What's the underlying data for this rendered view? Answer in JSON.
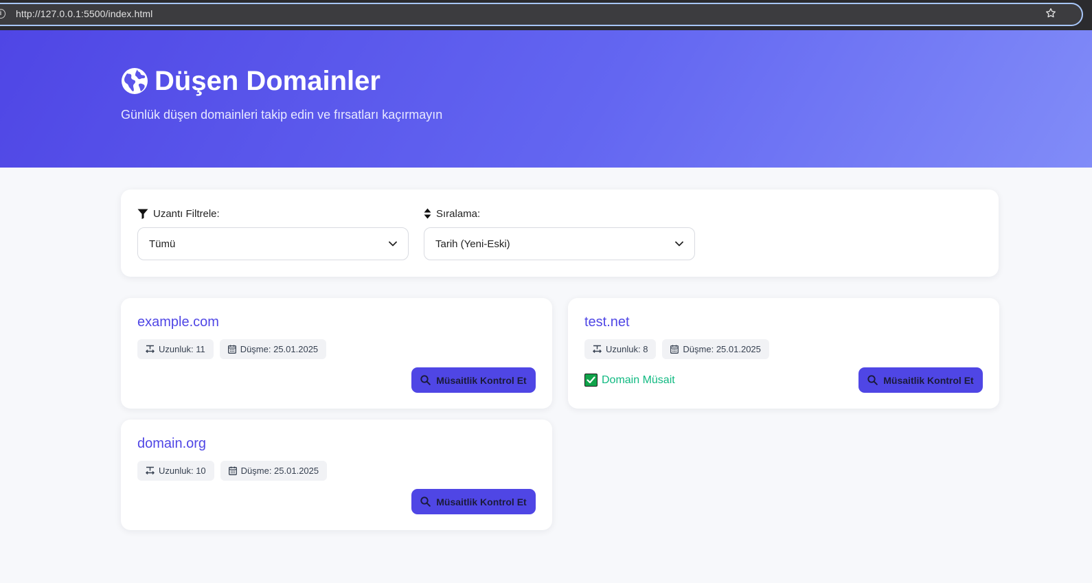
{
  "browser": {
    "url": "http://127.0.0.1:5500/index.html"
  },
  "header": {
    "title": "Düşen Domainler",
    "subtitle": "Günlük düşen domainleri takip edin ve fırsatları kaçırmayın"
  },
  "filters": {
    "extension": {
      "label": "Uzantı Filtrele:",
      "selected": "Tümü"
    },
    "sort": {
      "label": "Sıralama:",
      "selected": "Tarih (Yeni-Eski)"
    }
  },
  "domains": [
    {
      "name": "example.com",
      "length": "Uzunluk: 11",
      "date": "Düşme: 25.01.2025",
      "status": "",
      "button": "Müsaitlik Kontrol Et"
    },
    {
      "name": "test.net",
      "length": "Uzunluk: 8",
      "date": "Düşme: 25.01.2025",
      "status": "Domain Müsait",
      "button": "Müsaitlik Kontrol Et"
    },
    {
      "name": "domain.org",
      "length": "Uzunluk: 10",
      "date": "Düşme: 25.01.2025",
      "status": "",
      "button": "Müsaitlik Kontrol Et"
    }
  ],
  "colors": {
    "accent": "#4f46e5",
    "success": "#10b981",
    "hero_start": "#4f46e5",
    "hero_end": "#818cf8"
  }
}
